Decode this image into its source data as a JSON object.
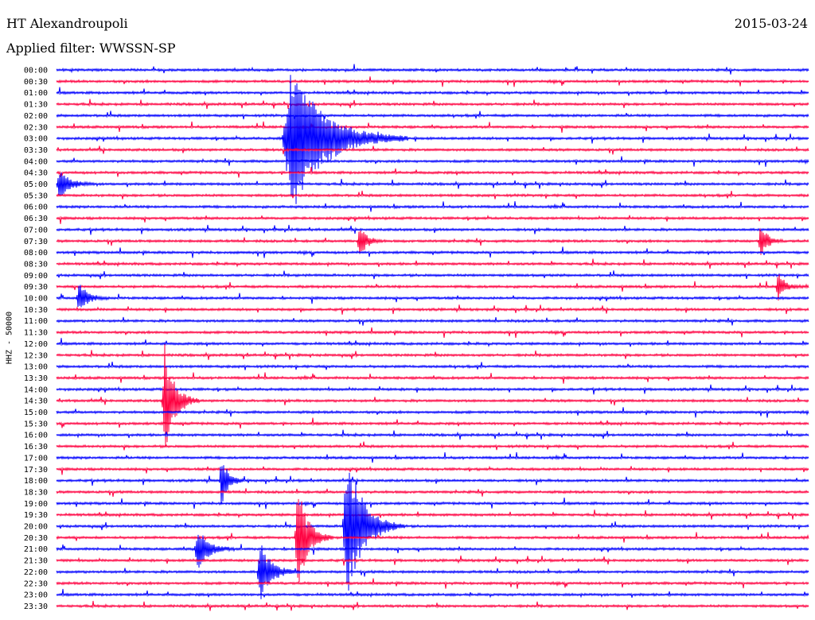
{
  "header": {
    "station": "HT Alexandroupoli",
    "filter_prefix": "Applied filter: ",
    "filter_name": "WWSSN-SP",
    "date": "2015-03-24"
  },
  "channel": {
    "label": "HHZ - 50000"
  },
  "colors": {
    "even_row": "#0000ff",
    "odd_row": "#ff0040",
    "text": "#000000",
    "background": "#ffffff"
  },
  "chart_data": {
    "type": "line",
    "title": "HT Alexandroupoli",
    "subtitle": "Applied filter: WWSSN-SP",
    "date": "2015-03-24",
    "ylabel": "HHZ - 50000",
    "row_minutes": 30,
    "rows": [
      "00:00",
      "00:30",
      "01:00",
      "01:30",
      "02:00",
      "02:30",
      "03:00",
      "03:30",
      "04:00",
      "04:30",
      "05:00",
      "05:30",
      "06:00",
      "06:30",
      "07:00",
      "07:30",
      "08:00",
      "08:30",
      "09:00",
      "09:30",
      "10:00",
      "10:30",
      "11:00",
      "11:30",
      "12:00",
      "12:30",
      "13:00",
      "13:30",
      "14:00",
      "14:30",
      "15:00",
      "15:30",
      "16:00",
      "16:30",
      "17:00",
      "17:30",
      "18:00",
      "18:30",
      "19:00",
      "19:30",
      "20:00",
      "20:30",
      "21:00",
      "21:30",
      "22:00",
      "22:30",
      "23:00",
      "23:30"
    ],
    "row_colors": [
      "blue",
      "red"
    ],
    "grid": false,
    "events": [
      {
        "row": "03:00",
        "start_min": 9.0,
        "duration_min": 5.0,
        "amplitude": 1.0
      },
      {
        "row": "14:30",
        "start_min": 4.2,
        "duration_min": 1.5,
        "amplitude": 0.75
      },
      {
        "row": "18:00",
        "start_min": 6.5,
        "duration_min": 1.0,
        "amplitude": 0.35
      },
      {
        "row": "20:00",
        "start_min": 11.4,
        "duration_min": 2.5,
        "amplitude": 1.0
      },
      {
        "row": "20:30",
        "start_min": 9.5,
        "duration_min": 1.5,
        "amplitude": 0.75
      },
      {
        "row": "21:00",
        "start_min": 5.5,
        "duration_min": 1.6,
        "amplitude": 0.3
      },
      {
        "row": "22:00",
        "start_min": 8.0,
        "duration_min": 1.7,
        "amplitude": 0.4
      },
      {
        "row": "07:30",
        "start_min": 12.0,
        "duration_min": 1.0,
        "amplitude": 0.25
      },
      {
        "row": "07:30",
        "start_min": 28.0,
        "duration_min": 1.0,
        "amplitude": 0.25
      },
      {
        "row": "09:30",
        "start_min": 28.7,
        "duration_min": 1.0,
        "amplitude": 0.2
      },
      {
        "row": "10:00",
        "start_min": 0.8,
        "duration_min": 1.3,
        "amplitude": 0.2
      },
      {
        "row": "05:00",
        "start_min": 0.0,
        "duration_min": 1.5,
        "amplitude": 0.2
      }
    ]
  }
}
